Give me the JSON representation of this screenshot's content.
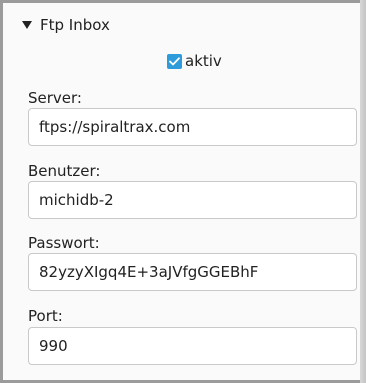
{
  "section": {
    "title": "Ftp Inbox",
    "expanded": true
  },
  "active": {
    "label": "aktiv",
    "checked": true,
    "accent": "#2e9cdb"
  },
  "fields": {
    "server": {
      "label": "Server:",
      "value": "ftps://spiraltrax.com"
    },
    "user": {
      "label": "Benutzer:",
      "value": "michidb-2"
    },
    "password": {
      "label": "Passwort:",
      "value": "82yzyXIgq4E+3aJVfgGGEBhF"
    },
    "port": {
      "label": "Port:",
      "value": "990"
    }
  },
  "icons": {
    "section_toggle": "triangle-down-icon",
    "checkbox": "checkmark-icon"
  }
}
